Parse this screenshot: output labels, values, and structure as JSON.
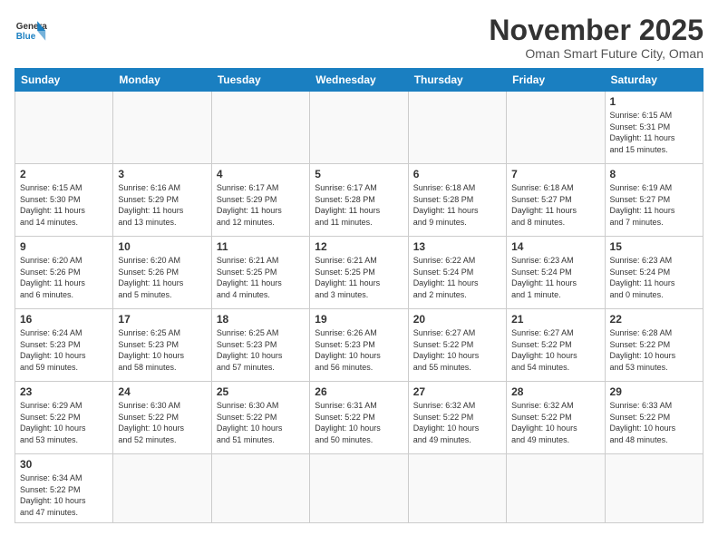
{
  "header": {
    "logo_text_general": "General",
    "logo_text_blue": "Blue",
    "title": "November 2025",
    "subtitle": "Oman Smart Future City, Oman"
  },
  "weekdays": [
    "Sunday",
    "Monday",
    "Tuesday",
    "Wednesday",
    "Thursday",
    "Friday",
    "Saturday"
  ],
  "days": [
    {
      "num": null,
      "info": null
    },
    {
      "num": null,
      "info": null
    },
    {
      "num": null,
      "info": null
    },
    {
      "num": null,
      "info": null
    },
    {
      "num": null,
      "info": null
    },
    {
      "num": null,
      "info": null
    },
    {
      "num": "1",
      "info": "Sunrise: 6:15 AM\nSunset: 5:31 PM\nDaylight: 11 hours\nand 15 minutes."
    },
    {
      "num": "2",
      "info": "Sunrise: 6:15 AM\nSunset: 5:30 PM\nDaylight: 11 hours\nand 14 minutes."
    },
    {
      "num": "3",
      "info": "Sunrise: 6:16 AM\nSunset: 5:29 PM\nDaylight: 11 hours\nand 13 minutes."
    },
    {
      "num": "4",
      "info": "Sunrise: 6:17 AM\nSunset: 5:29 PM\nDaylight: 11 hours\nand 12 minutes."
    },
    {
      "num": "5",
      "info": "Sunrise: 6:17 AM\nSunset: 5:28 PM\nDaylight: 11 hours\nand 11 minutes."
    },
    {
      "num": "6",
      "info": "Sunrise: 6:18 AM\nSunset: 5:28 PM\nDaylight: 11 hours\nand 9 minutes."
    },
    {
      "num": "7",
      "info": "Sunrise: 6:18 AM\nSunset: 5:27 PM\nDaylight: 11 hours\nand 8 minutes."
    },
    {
      "num": "8",
      "info": "Sunrise: 6:19 AM\nSunset: 5:27 PM\nDaylight: 11 hours\nand 7 minutes."
    },
    {
      "num": "9",
      "info": "Sunrise: 6:20 AM\nSunset: 5:26 PM\nDaylight: 11 hours\nand 6 minutes."
    },
    {
      "num": "10",
      "info": "Sunrise: 6:20 AM\nSunset: 5:26 PM\nDaylight: 11 hours\nand 5 minutes."
    },
    {
      "num": "11",
      "info": "Sunrise: 6:21 AM\nSunset: 5:25 PM\nDaylight: 11 hours\nand 4 minutes."
    },
    {
      "num": "12",
      "info": "Sunrise: 6:21 AM\nSunset: 5:25 PM\nDaylight: 11 hours\nand 3 minutes."
    },
    {
      "num": "13",
      "info": "Sunrise: 6:22 AM\nSunset: 5:24 PM\nDaylight: 11 hours\nand 2 minutes."
    },
    {
      "num": "14",
      "info": "Sunrise: 6:23 AM\nSunset: 5:24 PM\nDaylight: 11 hours\nand 1 minute."
    },
    {
      "num": "15",
      "info": "Sunrise: 6:23 AM\nSunset: 5:24 PM\nDaylight: 11 hours\nand 0 minutes."
    },
    {
      "num": "16",
      "info": "Sunrise: 6:24 AM\nSunset: 5:23 PM\nDaylight: 10 hours\nand 59 minutes."
    },
    {
      "num": "17",
      "info": "Sunrise: 6:25 AM\nSunset: 5:23 PM\nDaylight: 10 hours\nand 58 minutes."
    },
    {
      "num": "18",
      "info": "Sunrise: 6:25 AM\nSunset: 5:23 PM\nDaylight: 10 hours\nand 57 minutes."
    },
    {
      "num": "19",
      "info": "Sunrise: 6:26 AM\nSunset: 5:23 PM\nDaylight: 10 hours\nand 56 minutes."
    },
    {
      "num": "20",
      "info": "Sunrise: 6:27 AM\nSunset: 5:22 PM\nDaylight: 10 hours\nand 55 minutes."
    },
    {
      "num": "21",
      "info": "Sunrise: 6:27 AM\nSunset: 5:22 PM\nDaylight: 10 hours\nand 54 minutes."
    },
    {
      "num": "22",
      "info": "Sunrise: 6:28 AM\nSunset: 5:22 PM\nDaylight: 10 hours\nand 53 minutes."
    },
    {
      "num": "23",
      "info": "Sunrise: 6:29 AM\nSunset: 5:22 PM\nDaylight: 10 hours\nand 53 minutes."
    },
    {
      "num": "24",
      "info": "Sunrise: 6:30 AM\nSunset: 5:22 PM\nDaylight: 10 hours\nand 52 minutes."
    },
    {
      "num": "25",
      "info": "Sunrise: 6:30 AM\nSunset: 5:22 PM\nDaylight: 10 hours\nand 51 minutes."
    },
    {
      "num": "26",
      "info": "Sunrise: 6:31 AM\nSunset: 5:22 PM\nDaylight: 10 hours\nand 50 minutes."
    },
    {
      "num": "27",
      "info": "Sunrise: 6:32 AM\nSunset: 5:22 PM\nDaylight: 10 hours\nand 49 minutes."
    },
    {
      "num": "28",
      "info": "Sunrise: 6:32 AM\nSunset: 5:22 PM\nDaylight: 10 hours\nand 49 minutes."
    },
    {
      "num": "29",
      "info": "Sunrise: 6:33 AM\nSunset: 5:22 PM\nDaylight: 10 hours\nand 48 minutes."
    },
    {
      "num": "30",
      "info": "Sunrise: 6:34 AM\nSunset: 5:22 PM\nDaylight: 10 hours\nand 47 minutes."
    },
    {
      "num": null,
      "info": null
    },
    {
      "num": null,
      "info": null
    },
    {
      "num": null,
      "info": null
    },
    {
      "num": null,
      "info": null
    },
    {
      "num": null,
      "info": null
    },
    {
      "num": null,
      "info": null
    }
  ]
}
